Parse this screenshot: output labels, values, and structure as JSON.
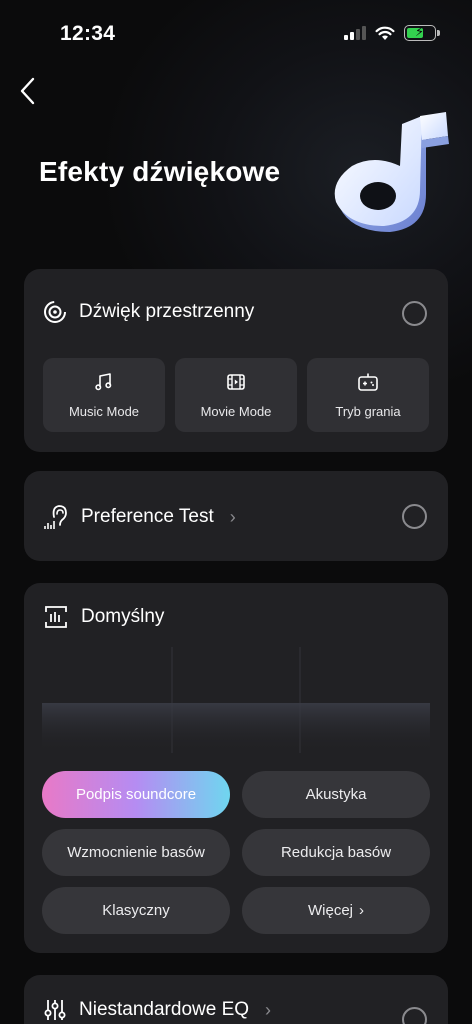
{
  "status": {
    "time": "12:34"
  },
  "header": {
    "title": "Efekty dźwiękowe"
  },
  "spatial": {
    "label": "Dźwięk przestrzenny",
    "modes": [
      {
        "label": "Music Mode",
        "icon": "music-note-icon"
      },
      {
        "label": "Movie Mode",
        "icon": "film-icon"
      },
      {
        "label": "Tryb grania",
        "icon": "gamepad-icon"
      }
    ]
  },
  "preference": {
    "label": "Preference Test"
  },
  "eq": {
    "label": "Domyślny",
    "presets": [
      {
        "label": "Podpis soundcore",
        "selected": true
      },
      {
        "label": "Akustyka",
        "selected": false
      },
      {
        "label": "Wzmocnienie basów",
        "selected": false
      },
      {
        "label": "Redukcja basów",
        "selected": false
      },
      {
        "label": "Klasyczny",
        "selected": false
      },
      {
        "label": "Więcej"
      }
    ]
  },
  "custom_eq": {
    "label": "Niestandardowe EQ"
  },
  "colors": {
    "accent_pink": "#e879c7",
    "accent_purple": "#b58cf2",
    "accent_cyan": "#6fd6ef",
    "card": "#212124"
  }
}
